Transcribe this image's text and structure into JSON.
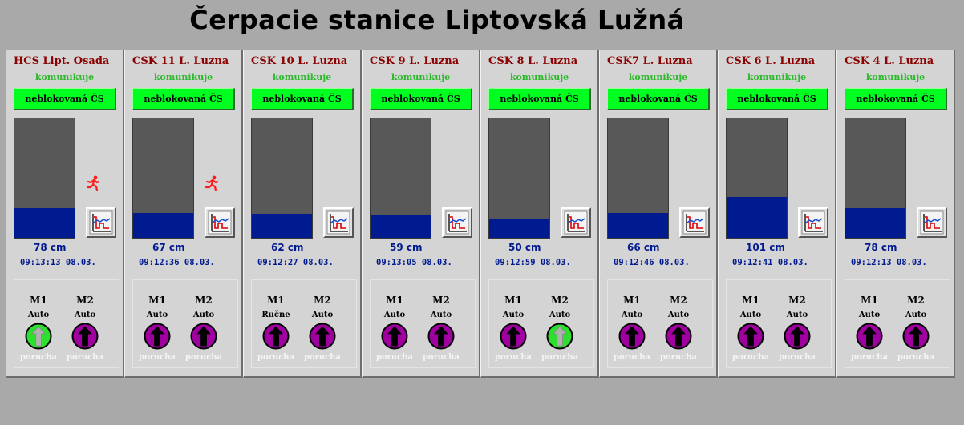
{
  "page": {
    "title": "Čerpacie stanice Liptovská Lužná"
  },
  "colors": {
    "background": "#a9a9a9",
    "panel": "#d4d4d4",
    "station_name": "#8b0000",
    "communication": "#2db82d",
    "block_button": "#00ff21",
    "tank_empty": "#585858",
    "tank_fill": "#001a8f",
    "motor_ok": "#2ee02e",
    "motor_fault": "#a000a0"
  },
  "stations": [
    {
      "name": "HCS Lipt. Osada",
      "comm": "komunikuje",
      "block": "neblokovaná ČS",
      "level": "78 cm",
      "level_fraction": 0.25,
      "timestamp": "09:13:13 08.03.",
      "running_icon": true,
      "trend_icon": "trend-chart-icon",
      "m1": {
        "name": "M1",
        "mode": "Auto",
        "state": "running",
        "fault": "porucha"
      },
      "m2": {
        "name": "M2",
        "mode": "Auto",
        "state": "stopped",
        "fault": "porucha"
      }
    },
    {
      "name": "CSK 11 L. Luzna",
      "comm": "komunikuje",
      "block": "neblokovaná ČS",
      "level": "67 cm",
      "level_fraction": 0.21,
      "timestamp": "09:12:36 08.03.",
      "running_icon": true,
      "trend_icon": "trend-chart-icon",
      "m1": {
        "name": "M1",
        "mode": "Auto",
        "state": "stopped",
        "fault": "porucha"
      },
      "m2": {
        "name": "M2",
        "mode": "Auto",
        "state": "stopped",
        "fault": "porucha"
      }
    },
    {
      "name": "CSK 10 L. Luzna",
      "comm": "komunikuje",
      "block": "neblokovaná ČS",
      "level": "62 cm",
      "level_fraction": 0.2,
      "timestamp": "09:12:27 08.03.",
      "running_icon": false,
      "trend_icon": "trend-chart-icon",
      "m1": {
        "name": "M1",
        "mode": "Ručne",
        "state": "stopped",
        "fault": "porucha"
      },
      "m2": {
        "name": "M2",
        "mode": "Auto",
        "state": "stopped",
        "fault": "porucha"
      }
    },
    {
      "name": "CSK 9 L. Luzna",
      "comm": "komunikuje",
      "block": "neblokovaná ČS",
      "level": "59 cm",
      "level_fraction": 0.19,
      "timestamp": "09:13:05 08.03.",
      "running_icon": false,
      "trend_icon": "trend-chart-icon",
      "m1": {
        "name": "M1",
        "mode": "Auto",
        "state": "stopped",
        "fault": "porucha"
      },
      "m2": {
        "name": "M2",
        "mode": "Auto",
        "state": "stopped",
        "fault": "porucha"
      }
    },
    {
      "name": "CSK 8 L. Luzna",
      "comm": "komunikuje",
      "block": "neblokovaná ČS",
      "level": "50 cm",
      "level_fraction": 0.16,
      "timestamp": "09:12:59 08.03.",
      "running_icon": false,
      "trend_icon": "trend-chart-icon",
      "m1": {
        "name": "M1",
        "mode": "Auto",
        "state": "stopped",
        "fault": "porucha"
      },
      "m2": {
        "name": "M2",
        "mode": "Auto",
        "state": "running",
        "fault": "porucha"
      }
    },
    {
      "name": "CSK7 L. Luzna",
      "comm": "komunikuje",
      "block": "neblokovaná ČS",
      "level": "66 cm",
      "level_fraction": 0.21,
      "timestamp": "09:12:46 08.03.",
      "running_icon": false,
      "trend_icon": "trend-chart-icon",
      "m1": {
        "name": "M1",
        "mode": "Auto",
        "state": "stopped",
        "fault": "porucha"
      },
      "m2": {
        "name": "M2",
        "mode": "Auto",
        "state": "stopped",
        "fault": "porucha"
      }
    },
    {
      "name": "CSK 6 L. Luzna",
      "comm": "komunikuje",
      "block": "neblokovaná ČS",
      "level": "101 cm",
      "level_fraction": 0.34,
      "timestamp": "09:12:41 08.03.",
      "running_icon": false,
      "trend_icon": "trend-chart-icon",
      "m1": {
        "name": "M1",
        "mode": "Auto",
        "state": "stopped",
        "fault": "porucha"
      },
      "m2": {
        "name": "M2",
        "mode": "Auto",
        "state": "stopped",
        "fault": "porucha"
      }
    },
    {
      "name": "CSK 4 L. Luzna",
      "comm": "komunikuje",
      "block": "neblokovaná ČS",
      "level": "78 cm",
      "level_fraction": 0.25,
      "timestamp": "09:12:13 08.03.",
      "running_icon": false,
      "trend_icon": "trend-chart-icon",
      "m1": {
        "name": "M1",
        "mode": "Auto",
        "state": "stopped",
        "fault": "porucha"
      },
      "m2": {
        "name": "M2",
        "mode": "Auto",
        "state": "stopped",
        "fault": "porucha"
      }
    }
  ]
}
